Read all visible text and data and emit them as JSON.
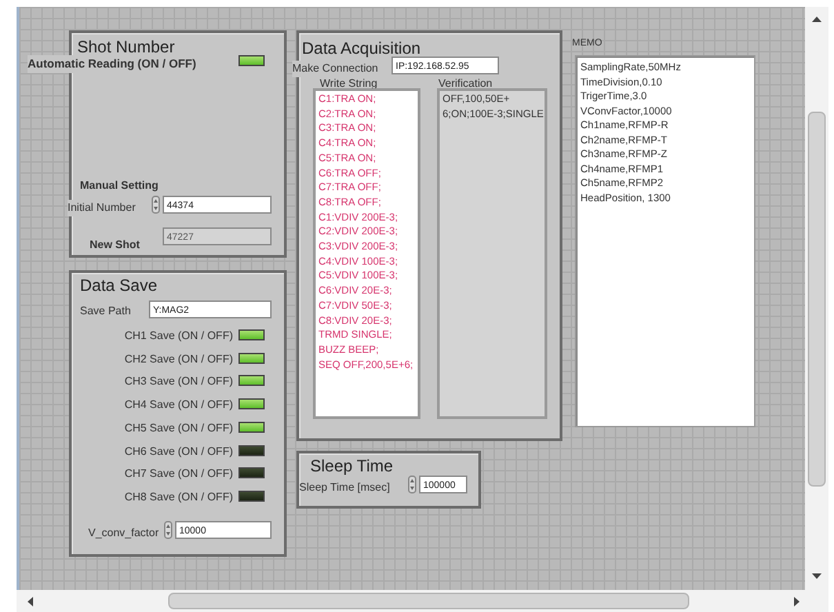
{
  "shot_number": {
    "title": "Shot Number",
    "auto_reading": {
      "label": "Automatic Reading (ON / OFF)",
      "on": true
    },
    "manual_setting": "Manual Setting",
    "initial_number": {
      "label": "Initial Number",
      "value": "44374"
    },
    "new_shot": {
      "label": "New Shot",
      "value": "47227"
    }
  },
  "data_save": {
    "title": "Data Save",
    "save_path": {
      "label": "Save Path",
      "value": "Y:MAG2"
    },
    "channels": [
      {
        "label": "CH1 Save (ON / OFF)",
        "on": true
      },
      {
        "label": "CH2 Save (ON / OFF)",
        "on": true
      },
      {
        "label": "CH3 Save (ON / OFF)",
        "on": true
      },
      {
        "label": "CH4 Save (ON / OFF)",
        "on": true
      },
      {
        "label": "CH5 Save (ON / OFF)",
        "on": true
      },
      {
        "label": "CH6 Save (ON / OFF)",
        "on": false
      },
      {
        "label": "CH7 Save (ON / OFF)",
        "on": false
      },
      {
        "label": "CH8 Save (ON / OFF)",
        "on": false
      }
    ],
    "v_conv_factor": {
      "label": "V_conv_factor",
      "value": "10000"
    }
  },
  "data_acquisition": {
    "title": "Data Acquisition",
    "make_connection": {
      "label": "Make Connection",
      "value": "IP:192.168.52.95"
    },
    "write_string": {
      "label": "Write String",
      "lines": [
        "C1:TRA ON;",
        "C2:TRA ON;",
        "C3:TRA ON;",
        "C4:TRA ON;",
        "C5:TRA ON;",
        "C6:TRA OFF;",
        "C7:TRA OFF;",
        "C8:TRA OFF;",
        "C1:VDIV 200E-3;",
        "C2:VDIV 200E-3;",
        "C3:VDIV 200E-3;",
        "C4:VDIV 100E-3;",
        "C5:VDIV 100E-3;",
        "C6:VDIV 20E-3;",
        "C7:VDIV 50E-3;",
        "C8:VDIV 20E-3;",
        "TRMD SINGLE;",
        "BUZZ BEEP;",
        "SEQ OFF,200,5E+6;"
      ]
    },
    "verification": {
      "label": "Verification",
      "lines": [
        "OFF,100,50E+",
        "6;ON;100E-3;SINGLE"
      ]
    }
  },
  "sleep_time": {
    "title": "Sleep Time",
    "label": "Sleep Time [msec]",
    "value": "100000"
  },
  "memo": {
    "label": "MEMO",
    "lines": [
      "SamplingRate,50MHz",
      "TimeDivision,0.10",
      "TrigerTime,3.0",
      "VConvFactor,10000",
      "Ch1name,RFMP-R",
      "Ch2name,RFMP-T",
      "Ch3name,RFMP-Z",
      "Ch4name,RFMP1",
      "Ch5name,RFMP2",
      "HeadPosition, 1300"
    ]
  }
}
